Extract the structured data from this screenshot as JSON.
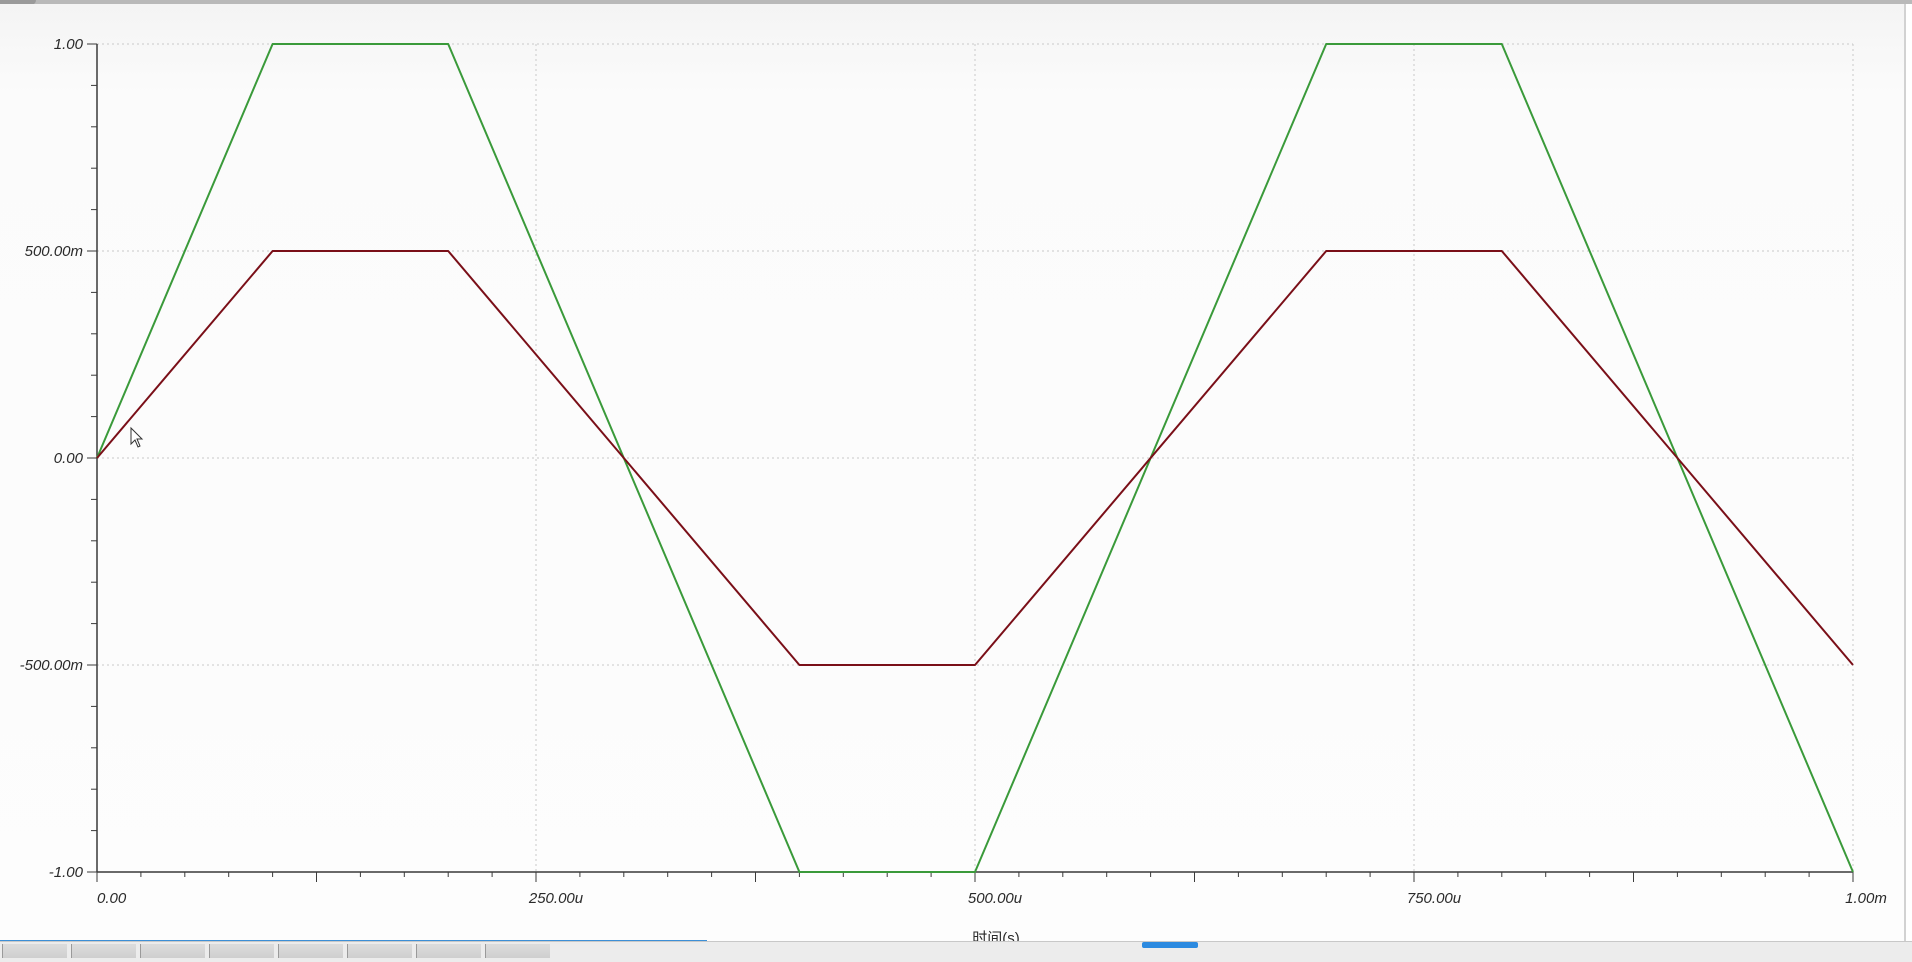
{
  "colors": {
    "series_1": "#3a9a3a",
    "series_2": "#7a0f18",
    "grid": "#c9c9c9",
    "axis": "#3a3a3a",
    "bottom_progress": "#3d8fd6"
  },
  "bottom_bar": {
    "progress": 0.37,
    "tab_count": 8
  },
  "chart_data": {
    "type": "line",
    "xlabel": "时间(s)",
    "ylabel": "",
    "xlim": [
      0,
      0.001
    ],
    "ylim": [
      -1,
      1
    ],
    "grid": true,
    "x_ticks": [
      {
        "value": 0,
        "label": "0.00"
      },
      {
        "value": 0.00025,
        "label": "250.00u"
      },
      {
        "value": 0.0005,
        "label": "500.00u"
      },
      {
        "value": 0.00075,
        "label": "750.00u"
      },
      {
        "value": 0.001,
        "label": "1.00m"
      }
    ],
    "y_ticks": [
      {
        "value": 1,
        "label": "1.00"
      },
      {
        "value": 0.5,
        "label": "500.00m"
      },
      {
        "value": 0,
        "label": "0.00"
      },
      {
        "value": -0.5,
        "label": "-500.00m"
      },
      {
        "value": -1,
        "label": "-1.00"
      }
    ],
    "series": [
      {
        "color": "#3a9a3a",
        "x": [
          0,
          0.0001,
          0.0002,
          0.0004,
          0.0005,
          0.0007,
          0.0008,
          0.001
        ],
        "y": [
          0,
          1,
          1,
          -1,
          -1,
          1,
          1,
          -1
        ]
      },
      {
        "color": "#7a0f18",
        "x": [
          0,
          0.0001,
          0.0002,
          0.0004,
          0.0005,
          0.0007,
          0.0008,
          0.001
        ],
        "y": [
          0,
          0.5,
          0.5,
          -0.5,
          -0.5,
          0.5,
          0.5,
          -0.5
        ]
      }
    ]
  }
}
